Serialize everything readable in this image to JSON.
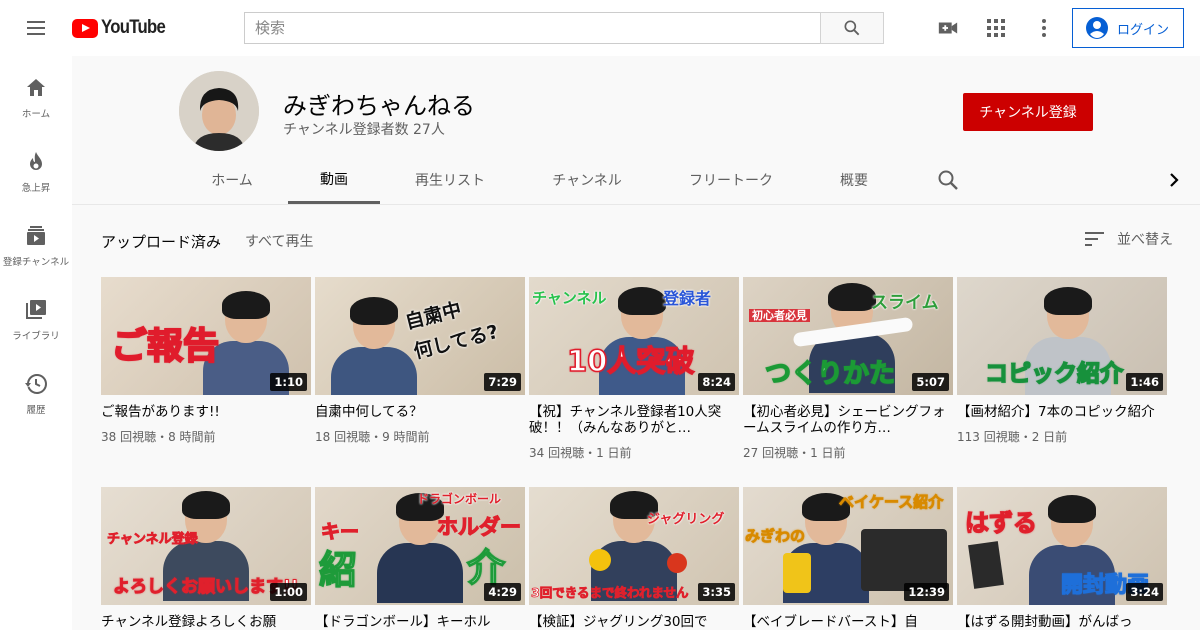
{
  "header": {
    "logo_text": "YouTube",
    "search_placeholder": "検索",
    "login_label": "ログイン"
  },
  "sidebar": {
    "items": [
      {
        "label": "ホーム",
        "icon": "home-icon"
      },
      {
        "label": "急上昇",
        "icon": "trending-icon"
      },
      {
        "label": "登録チャンネル",
        "icon": "subscriptions-icon"
      },
      {
        "label": "ライブラリ",
        "icon": "library-icon"
      },
      {
        "label": "履歴",
        "icon": "history-icon"
      }
    ]
  },
  "channel": {
    "name": "みぎわちゃんねる",
    "subscribers": "チャンネル登録者数 27人",
    "subscribe_label": "チャンネル登録",
    "tabs": [
      "ホーム",
      "動画",
      "再生リスト",
      "チャンネル",
      "フリートーク",
      "概要"
    ],
    "active_tab": "動画"
  },
  "section": {
    "title": "アップロード済み",
    "play_all": "すべて再生",
    "sort_label": "並べ替え"
  },
  "videos": [
    {
      "title": "ご報告があります!!",
      "meta": "38 回視聴・8 時間前",
      "duration": "1:10",
      "overlay": "ご報告",
      "overlay2": ""
    },
    {
      "title": "自粛中何してる？",
      "meta": "18 回視聴・9 時間前",
      "duration": "7:29",
      "overlay": "自粛中",
      "overlay2": "何してる?"
    },
    {
      "title": "【祝】チャンネル登録者10人突破！！（みんなありがと…",
      "meta": "34 回視聴・1 日前",
      "duration": "8:24",
      "overlay": "10人突破",
      "overlay2": "チャンネル",
      "overlay3": "登録者"
    },
    {
      "title": "【初心者必見】シェービングフォームスライムの作り方…",
      "meta": "27 回視聴・1 日前",
      "duration": "5:07",
      "overlay": "つくりかた",
      "overlay2": "初心者必見",
      "overlay3": "スライム"
    },
    {
      "title": "【画材紹介】7本のコピック紹介",
      "meta": "113 回視聴・2 日前",
      "duration": "1:46",
      "overlay": "コピック紹介",
      "overlay2": ""
    },
    {
      "title": "チャンネル登録よろしくお願",
      "meta": "",
      "duration": "1:00",
      "overlay": "よろしくお願いします!!",
      "overlay2": "チャンネル登録"
    },
    {
      "title": "【ドラゴンボール】キーホル",
      "meta": "",
      "duration": "4:29",
      "overlay": "キー",
      "overlay2": "ホルダー",
      "overlay3": "ドラゴンボール",
      "overlay4": "紹",
      "overlay5": "介"
    },
    {
      "title": "【検証】ジャグリング30回で",
      "meta": "",
      "duration": "3:35",
      "overlay": "3回できるまで終われません",
      "overlay2": "ジャグリング"
    },
    {
      "title": "【ベイブレードバースト】自",
      "meta": "",
      "duration": "12:39",
      "overlay": "みぎわの",
      "overlay2": "ベイケース紹介"
    },
    {
      "title": "【はずる開封動画】がんばっ",
      "meta": "",
      "duration": "3:24",
      "overlay": "はずる",
      "overlay2": "開封動画"
    }
  ]
}
